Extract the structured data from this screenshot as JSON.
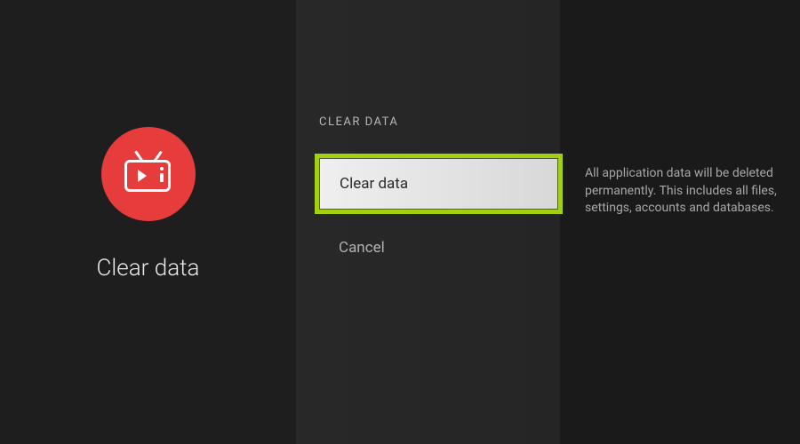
{
  "page": {
    "title": "Clear data"
  },
  "section": {
    "header": "CLEAR DATA"
  },
  "options": {
    "clear_data": "Clear data",
    "cancel": "Cancel"
  },
  "description": {
    "text": "All application data will be deleted permanently. This includes all files, settings, accounts and databases."
  },
  "icon": {
    "name": "tv-play-icon",
    "background_color": "#e73c3c"
  }
}
